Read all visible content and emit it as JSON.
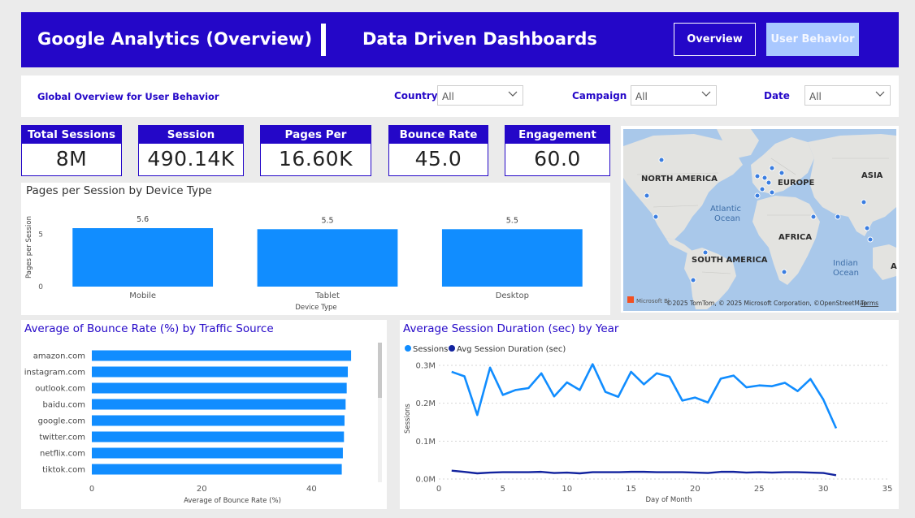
{
  "header": {
    "title": "Google Analytics (Overview)",
    "subtitle": "Data Driven Dashboards",
    "nav_overview": "Overview",
    "nav_user_behavior": "User Behavior"
  },
  "filters": {
    "heading": "Global Overview for User Behavior",
    "country_label": "Country",
    "country_value": "All",
    "campaign_label": "Campaign",
    "campaign_value": "All",
    "date_label": "Date",
    "date_value": "All"
  },
  "kpis": [
    {
      "label": "Total Sessions",
      "value": "8M"
    },
    {
      "label": "Session Duration",
      "value": "490.14K"
    },
    {
      "label": "Pages Per Session",
      "value": "16.60K"
    },
    {
      "label": "Bounce Rate",
      "value": "45.0"
    },
    {
      "label": "Engagement Rate",
      "value": "60.0"
    }
  ],
  "map": {
    "labels": {
      "north_america": "NORTH AMERICA",
      "europe": "EUROPE",
      "asia": "ASIA",
      "africa": "AFRICA",
      "south_america": "SOUTH AMERICA",
      "atlantic1": "Atlantic",
      "atlantic2": "Ocean",
      "indian1": "Indian",
      "indian2": "Ocean",
      "edge": "A"
    },
    "attribution": "©2025 TomTom, © 2025 Microsoft Corporation, ©OpenStreetMap",
    "terms": "Terms",
    "bing": "Microsoft Bi",
    "colors": {
      "water": "#a9c8ea",
      "land": "#e3e3e0",
      "pin": "#3a7de0"
    }
  },
  "chart_data": [
    {
      "type": "bar",
      "title": "Pages per Session by Device Type",
      "xlabel": "Device Type",
      "ylabel": "Pages per Session",
      "categories": [
        "Mobile",
        "Tablet",
        "Desktop"
      ],
      "values": [
        5.6,
        5.5,
        5.5
      ],
      "data_labels": [
        "5.6",
        "5.5",
        "5.5"
      ],
      "yticks": [
        "0",
        "5"
      ],
      "ylim": [
        0,
        7
      ],
      "color": "#118dff"
    },
    {
      "type": "bar",
      "orientation": "horizontal",
      "title": "Average of Bounce Rate (%) by Traffic Source",
      "xlabel": "Average of Bounce Rate (%)",
      "categories": [
        "amazon.com",
        "instagram.com",
        "outlook.com",
        "baidu.com",
        "google.com",
        "twitter.com",
        "netflix.com",
        "tiktok.com"
      ],
      "values": [
        47.2,
        46.6,
        46.4,
        46.2,
        46.0,
        45.9,
        45.7,
        45.5
      ],
      "xticks": [
        "0",
        "20",
        "40"
      ],
      "xlim": [
        0,
        50
      ],
      "color": "#118dff"
    },
    {
      "type": "line",
      "title": "Average Session Duration (sec) by Year",
      "xlabel": "Day of Month",
      "ylabel": "Sessions",
      "legend": [
        "Sessions",
        "Avg Session Duration (sec)"
      ],
      "xticks": [
        "0",
        "5",
        "10",
        "15",
        "20",
        "25",
        "30",
        "35"
      ],
      "yticks": [
        "0.0M",
        "0.1M",
        "0.2M",
        "0.3M"
      ],
      "xlim": [
        0,
        35
      ],
      "ylim": [
        0,
        0.3
      ],
      "x": [
        1,
        2,
        3,
        4,
        5,
        6,
        7,
        8,
        9,
        10,
        11,
        12,
        13,
        14,
        15,
        16,
        17,
        18,
        19,
        20,
        21,
        22,
        23,
        24,
        25,
        26,
        27,
        28,
        29,
        30,
        31
      ],
      "series": [
        {
          "name": "Sessions",
          "color": "#118dff",
          "values": [
            0.283,
            0.271,
            0.169,
            0.294,
            0.222,
            0.235,
            0.24,
            0.279,
            0.218,
            0.255,
            0.235,
            0.303,
            0.23,
            0.217,
            0.283,
            0.25,
            0.279,
            0.27,
            0.207,
            0.215,
            0.202,
            0.265,
            0.273,
            0.242,
            0.247,
            0.245,
            0.254,
            0.232,
            0.264,
            0.21,
            0.134
          ]
        },
        {
          "name": "Avg Session Duration (sec)",
          "color": "#12239e",
          "values": [
            0.022,
            0.019,
            0.015,
            0.017,
            0.018,
            0.018,
            0.018,
            0.019,
            0.016,
            0.017,
            0.015,
            0.018,
            0.018,
            0.018,
            0.019,
            0.019,
            0.018,
            0.018,
            0.018,
            0.017,
            0.016,
            0.019,
            0.019,
            0.017,
            0.018,
            0.017,
            0.018,
            0.018,
            0.017,
            0.016,
            0.01
          ]
        }
      ]
    }
  ]
}
